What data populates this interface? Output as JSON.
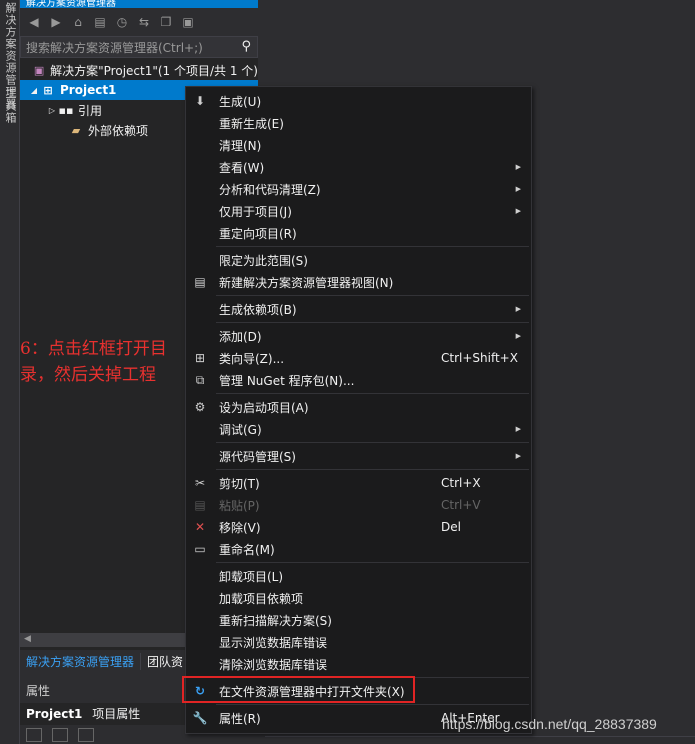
{
  "left_strip": {
    "tab1": "解决方案资源管理器",
    "tab2": "工具箱"
  },
  "panel": {
    "title": "解决方案资源管理器",
    "search_placeholder": "搜索解决方案资源管理器(Ctrl+;)",
    "tree": {
      "solution": "解决方案\"Project1\"(1 个项目/共 1 个)",
      "project": "Project1",
      "references": "引用",
      "external_deps": "外部依赖项"
    }
  },
  "annotation": "6：点击红框打开目录，然后关掉工程",
  "bottom_tabs": {
    "active": "解决方案资源管理器",
    "other": "团队资"
  },
  "properties": {
    "title": "属性",
    "object_name": "Project1",
    "object_type": "项目属性"
  },
  "menu": {
    "build": "生成(U)",
    "rebuild": "重新生成(E)",
    "clean": "清理(N)",
    "view": "查看(W)",
    "analyze": "分析和代码清理(Z)",
    "project_only": "仅用于项目(J)",
    "retarget": "重定向项目(R)",
    "scope": "限定为此范围(S)",
    "new_view": "新建解决方案资源管理器视图(N)",
    "build_deps": "生成依赖项(B)",
    "add": "添加(D)",
    "class_wizard": "类向导(Z)...",
    "class_wizard_sc": "Ctrl+Shift+X",
    "nuget": "管理 NuGet 程序包(N)...",
    "set_startup": "设为启动项目(A)",
    "debug": "调试(G)",
    "source_control": "源代码管理(S)",
    "cut": "剪切(T)",
    "cut_sc": "Ctrl+X",
    "paste": "粘贴(P)",
    "paste_sc": "Ctrl+V",
    "remove": "移除(V)",
    "remove_sc": "Del",
    "rename": "重命名(M)",
    "unload": "卸载项目(L)",
    "load_deps": "加载项目依赖项",
    "rescan": "重新扫描解决方案(S)",
    "show_db_errors": "显示浏览数据库错误",
    "clear_db_errors": "清除浏览数据库错误",
    "open_in_explorer": "在文件资源管理器中打开文件夹(X)",
    "properties": "属性(R)",
    "properties_sc": "Alt+Enter"
  },
  "watermark": "https://blog.csdn.net/qq_28837389",
  "colors": {
    "accent": "#007acc",
    "highlight_box": "#e02424",
    "annotation": "#e8312f"
  }
}
